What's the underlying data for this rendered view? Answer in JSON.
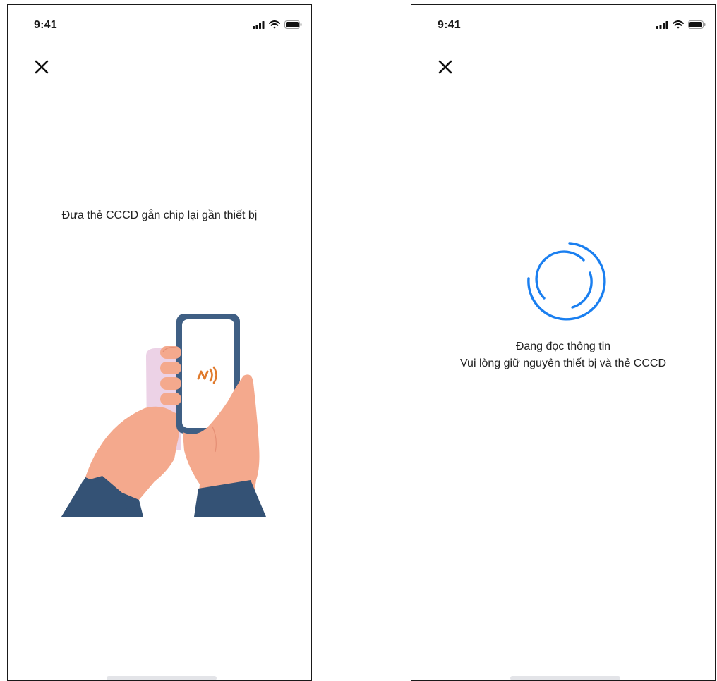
{
  "screens": [
    {
      "status": {
        "time": "9:41"
      },
      "instruction": "Đưa thẻ CCCD gắn chip lại gần thiết bị"
    },
    {
      "status": {
        "time": "9:41"
      },
      "reading": {
        "title": "Đang đọc thông tin",
        "subtitle": "Vui lòng giữ nguyên thiết bị và thẻ CCCD"
      }
    }
  ],
  "icons": {
    "close": "close-icon",
    "signal": "cellular-signal-icon",
    "wifi": "wifi-icon",
    "battery": "battery-icon",
    "nfc": "nfc-icon",
    "spinner": "loading-spinner-icon"
  },
  "colors": {
    "spinner": "#1a7ff0",
    "nfc": "#e07a2c",
    "phone_frame": "#3f5f84",
    "skin": "#f4a98d",
    "sleeve": "#345275",
    "card": "#ecd2e6"
  }
}
